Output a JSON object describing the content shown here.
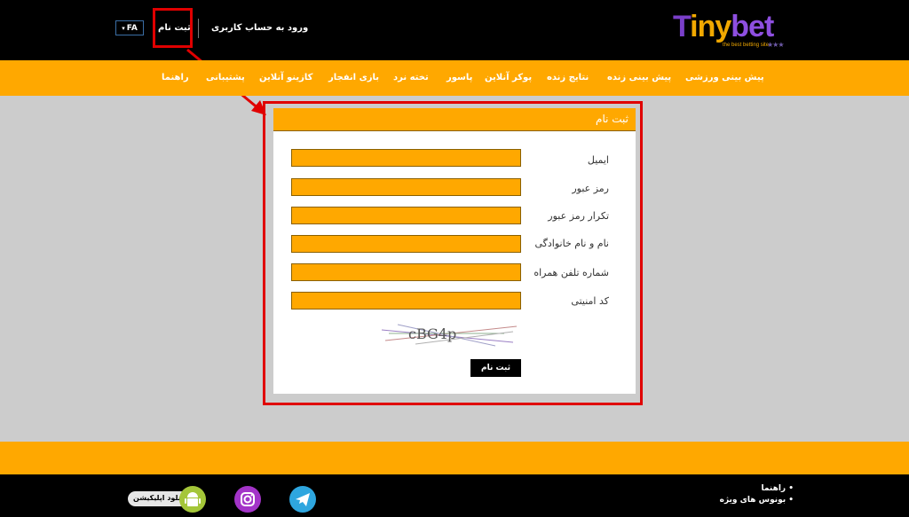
{
  "header": {
    "logo": {
      "part1": "T",
      "part2": "iny",
      "part3": "bet",
      "tagline": "the best betting site",
      "stars": "★★★"
    },
    "login_label": "ورود به حساب کاربری",
    "register_label": "ثبت نام",
    "lang_label": "FA",
    "lang_caret": "▾"
  },
  "nav": {
    "items": [
      {
        "label": "پیش بینی ورزشی"
      },
      {
        "label": "پیش بینی زنده"
      },
      {
        "label": "نتایج زنده"
      },
      {
        "label": "پوکر آنلاین"
      },
      {
        "label": "پاسور"
      },
      {
        "label": "تخته نرد"
      },
      {
        "label": "بازی انفجار"
      },
      {
        "label": "کازینو آنلاین"
      },
      {
        "label": "پشتیبانی"
      },
      {
        "label": "راهنما"
      }
    ]
  },
  "form": {
    "title": "ثبت نام",
    "fields": [
      {
        "label": "ایمیل",
        "value": ""
      },
      {
        "label": "رمز عبور",
        "value": ""
      },
      {
        "label": "تکرار رمز عبور",
        "value": ""
      },
      {
        "label": "نام و نام خانوادگی",
        "value": ""
      },
      {
        "label": "شماره تلفن همراه",
        "value": ""
      },
      {
        "label": "کد امنیتی",
        "value": ""
      }
    ],
    "captcha_text": "cBG4p",
    "submit_label": "ثبت نام"
  },
  "footer": {
    "links": [
      {
        "label": "• راهنما"
      },
      {
        "label": "• بونوس های ویژه"
      }
    ],
    "app_download_label": "دانلود اپلیکیشن"
  },
  "colors": {
    "accent": "#ffa800",
    "highlight": "#e00000",
    "background": "#cccccc"
  }
}
